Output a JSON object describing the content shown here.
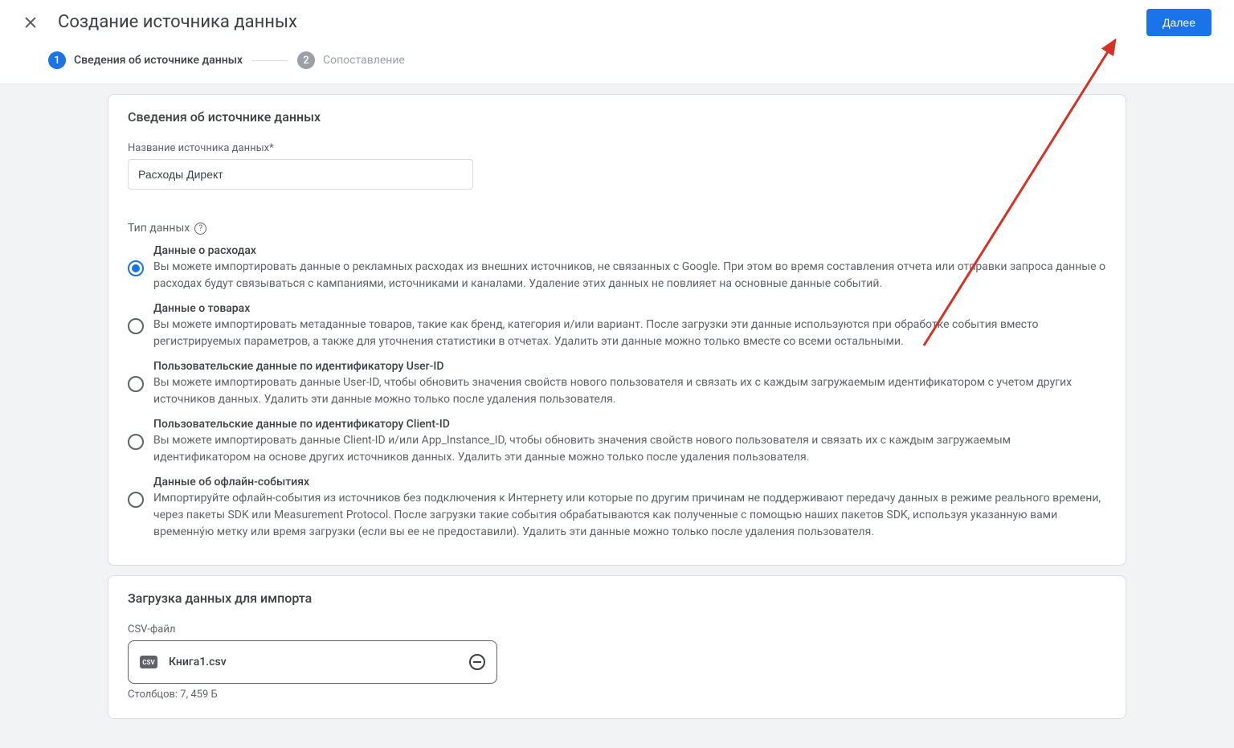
{
  "header": {
    "title": "Создание источника данных",
    "next_button": "Далее"
  },
  "stepper": {
    "step1_num": "1",
    "step1_label": "Сведения об источнике данных",
    "step2_num": "2",
    "step2_label": "Сопоставление"
  },
  "card1": {
    "title": "Сведения об источнике данных",
    "name_label": "Название источника данных*",
    "name_value": "Расходы Директ",
    "type_label": "Тип данных",
    "options": [
      {
        "title": "Данные о расходах",
        "desc": "Вы можете импортировать данные о рекламных расходах из внешних источников, не связанных с Google. При этом во время составления отчета или отправки запроса данные о расходах будут связываться с кампаниями, источниками и каналами. Удаление этих данных не повлияет на основные данные событий."
      },
      {
        "title": "Данные о товарах",
        "desc": "Вы можете импортировать метаданные товаров, такие как бренд, категория и/или вариант. После загрузки эти данные используются при обработке события вместо регистрируемых параметров, а также для уточнения статистики в отчетах. Удалить эти данные можно только вместе со всеми остальными."
      },
      {
        "title": "Пользовательские данные по идентификатору User-ID",
        "desc": "Вы можете импортировать данные User-ID, чтобы обновить значения свойств нового пользователя и связать их с каждым загружаемым идентификатором с учетом других источников данных. Удалить эти данные можно только после удаления пользователя."
      },
      {
        "title": "Пользовательские данные по идентификатору Client-ID",
        "desc": "Вы можете импортировать данные Client-ID и/или App_Instance_ID, чтобы обновить значения свойств нового пользователя и связать их с каждым загружаемым идентификатором на основе других источников данных. Удалить эти данные можно только после удаления пользователя."
      },
      {
        "title": "Данные об офлайн-событиях",
        "desc": "Импортируйте офлайн-события из источников без подключения к Интернету или которые по другим причинам не поддерживают передачу данных в режиме реального времени, через пакеты SDK или Measurement Protocol. После загрузки такие события обрабатываются как полученные с помощью наших пакетов SDK, используя указанную вами временну́ю метку или время загрузки (если вы ее не предоставили). Удалить эти данные можно только после удаления пользователя."
      }
    ]
  },
  "card2": {
    "title": "Загрузка данных для импорта",
    "file_label": "CSV-файл",
    "csv_badge": "CSV",
    "file_name": "Книга1.csv",
    "file_stats": "Столбцов: 7, 459 Б"
  }
}
